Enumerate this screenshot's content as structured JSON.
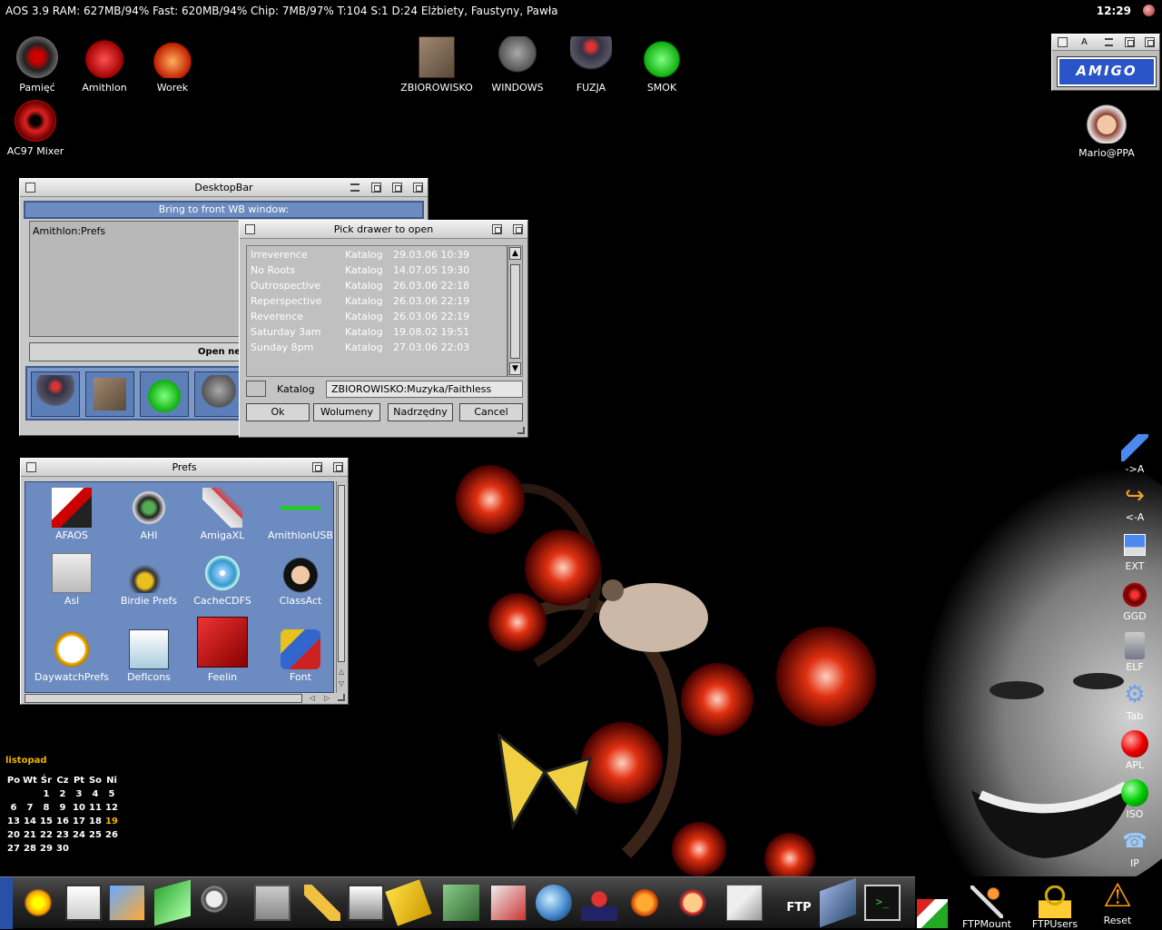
{
  "screen": {
    "status_text": "AOS 3.9  RAM: 627MB/94% Fast: 620MB/94% Chip: 7MB/97%  T:104 S:1 D:24  Elżbiety, Faustyny, Pawła",
    "clock": "12:29"
  },
  "desktop_icons": [
    {
      "label": "Pamięć",
      "icon": "memory-gauge-icon"
    },
    {
      "label": "Amithlon",
      "icon": "red-dragon-icon"
    },
    {
      "label": "Worek",
      "icon": "red-demon-icon"
    },
    {
      "label": "ZBIOROWISKO",
      "icon": "stone-box-icon"
    },
    {
      "label": "WINDOWS",
      "icon": "gargoyle-icon"
    },
    {
      "label": "FUZJA",
      "icon": "dark-robot-icon"
    },
    {
      "label": "SMOK",
      "icon": "green-dragon-icon"
    },
    {
      "label": "AC97 Mixer",
      "icon": "speaker-icon"
    },
    {
      "label": "Mario@PPA",
      "icon": "user-avatar-icon"
    }
  ],
  "amigo_widget": {
    "buttons": [
      "A"
    ],
    "logo_text": "AMIGO"
  },
  "desktopbar": {
    "title": "DesktopBar",
    "header": "Bring to front WB window:",
    "list_items": [
      "Amithlon:Prefs"
    ],
    "open_button": "Open ne"
  },
  "picker": {
    "title": "Pick drawer to open",
    "rows": [
      {
        "name": "Irreverence",
        "type": "Katalog",
        "date": "29.03.06 10:39"
      },
      {
        "name": "No Roots",
        "type": "Katalog",
        "date": "14.07.05 19:30"
      },
      {
        "name": "Outrospective",
        "type": "Katalog",
        "date": "26.03.06 22:18"
      },
      {
        "name": "Reperspective",
        "type": "Katalog",
        "date": "26.03.06 22:19"
      },
      {
        "name": "Reverence",
        "type": "Katalog",
        "date": "26.03.06 22:19"
      },
      {
        "name": "Saturday 3am",
        "type": "Katalog",
        "date": "19.08.02 19:51"
      },
      {
        "name": "Sunday 8pm",
        "type": "Katalog",
        "date": "27.03.06 22:03"
      }
    ],
    "path_label": "Katalog",
    "path_value": "ZBIOROWISKO:Muzyka/Faithless",
    "buttons": {
      "ok": "Ok",
      "volumes": "Wolumeny",
      "parent": "Nadrzędny",
      "cancel": "Cancel"
    }
  },
  "prefs": {
    "title": "Prefs",
    "icons": [
      {
        "label": "AFAOS"
      },
      {
        "label": "AHI"
      },
      {
        "label": "AmigaXL"
      },
      {
        "label": "AmithlonUSB"
      },
      {
        "label": "Asl"
      },
      {
        "label": "Birdie Prefs"
      },
      {
        "label": "CacheCDFS"
      },
      {
        "label": "ClassAct"
      },
      {
        "label": "DaywatchPrefs"
      },
      {
        "label": "DefIcons"
      },
      {
        "label": "Feelin"
      },
      {
        "label": "Font"
      }
    ]
  },
  "calendar": {
    "month": "listopad",
    "weekdays": [
      "Po",
      "Wt",
      "Śr",
      "Cz",
      "Pt",
      "So",
      "Ni"
    ],
    "weeks": [
      [
        "",
        "",
        "",
        "1",
        "2",
        "3",
        "4",
        "5"
      ],
      [
        "6",
        "7",
        "8",
        "9",
        "10",
        "11",
        "12"
      ],
      [
        "13",
        "14",
        "15",
        "16",
        "17",
        "18",
        "19"
      ],
      [
        "20",
        "21",
        "22",
        "23",
        "24",
        "25",
        "26"
      ],
      [
        "27",
        "28",
        "29",
        "30",
        "",
        "",
        ""
      ]
    ],
    "today": "19"
  },
  "right_appicons": [
    {
      "label": "->A",
      "icon": "pencil-icon"
    },
    {
      "label": "<-A",
      "icon": "arrow-back-icon"
    },
    {
      "label": "EXT",
      "icon": "floppy-icon"
    },
    {
      "label": "GGD",
      "icon": "radar-icon"
    },
    {
      "label": "ELF",
      "icon": "stack-icon"
    },
    {
      "label": "Tab",
      "icon": "gear-icon"
    },
    {
      "label": "APL",
      "icon": "red-ball-icon"
    },
    {
      "label": "ISO",
      "icon": "green-ball-icon"
    },
    {
      "label": "IP",
      "icon": "network-icon"
    }
  ],
  "bottom_icons": [
    {
      "label": "FTPMount",
      "icon": "magic-wand-icon"
    },
    {
      "label": "FTPUsers",
      "icon": "padlock-icon"
    },
    {
      "label": "Reset",
      "icon": "warning-icon"
    }
  ]
}
